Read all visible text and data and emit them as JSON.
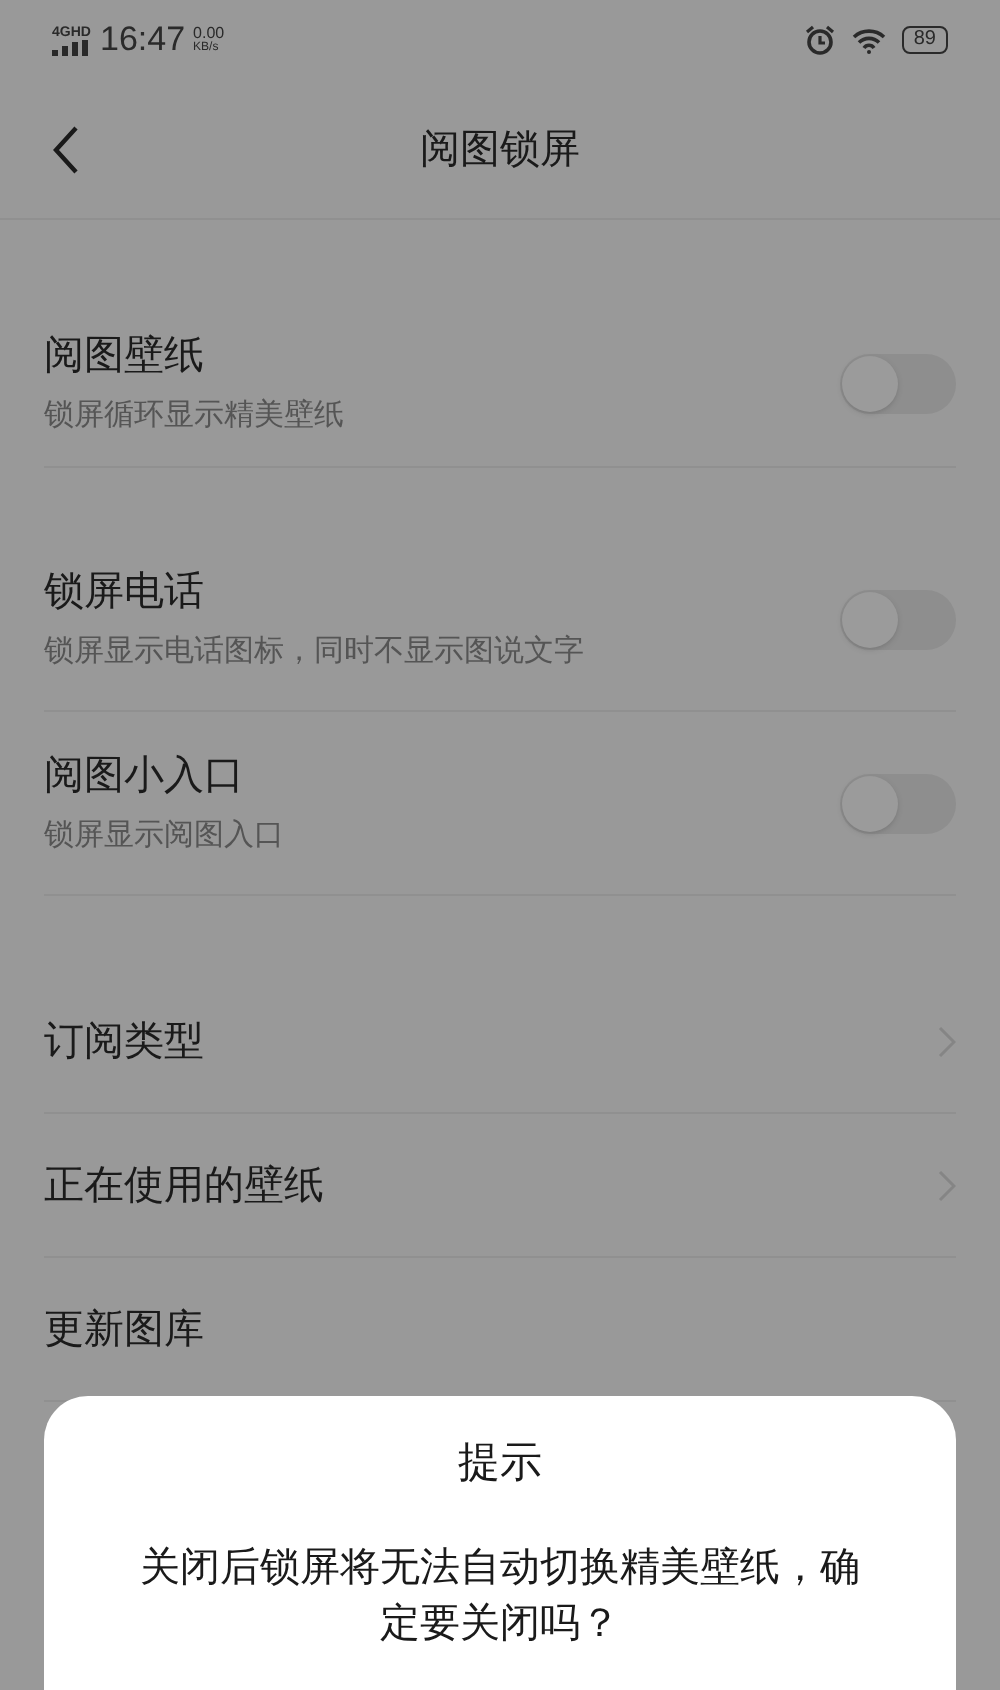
{
  "status_bar": {
    "network": "4GHD",
    "time": "16:47",
    "speed": "0.00",
    "speed_unit": "KB/s",
    "battery": "89"
  },
  "header": {
    "title": "阅图锁屏"
  },
  "sections": [
    {
      "items": [
        {
          "kind": "toggle",
          "title": "阅图壁纸",
          "subtitle": "锁屏循环显示精美壁纸",
          "on": false
        }
      ]
    },
    {
      "items": [
        {
          "kind": "toggle",
          "title": "锁屏电话",
          "subtitle": "锁屏显示电话图标，同时不显示图说文字",
          "on": false
        },
        {
          "kind": "toggle",
          "title": "阅图小入口",
          "subtitle": "锁屏显示阅图入口",
          "on": false
        }
      ]
    },
    {
      "items": [
        {
          "kind": "link",
          "title": "订阅类型"
        },
        {
          "kind": "link",
          "title": "正在使用的壁纸"
        },
        {
          "kind": "plain",
          "title": "更新图库"
        }
      ]
    }
  ],
  "dialog": {
    "title": "提示",
    "message": "关闭后锁屏将无法自动切换精美壁纸，确定要关闭吗？"
  }
}
